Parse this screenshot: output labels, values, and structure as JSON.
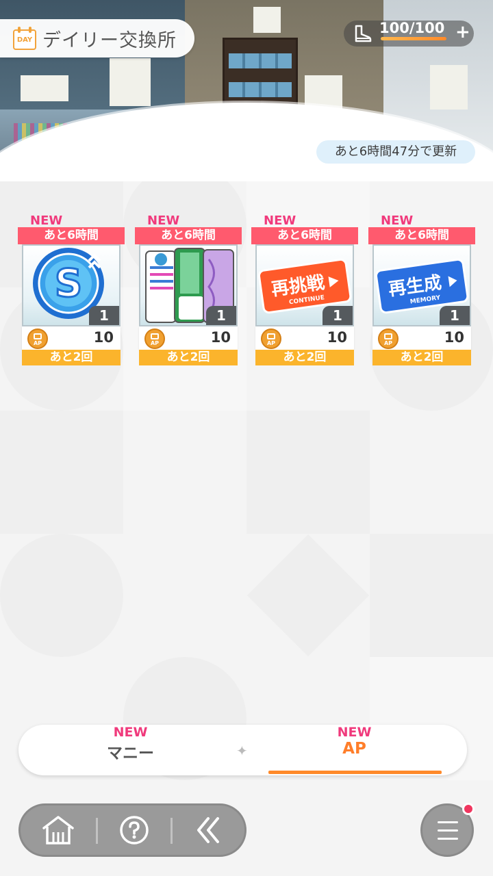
{
  "header": {
    "calendar_badge": "DAY",
    "title": "デイリー交換所",
    "stamina": "100/100",
    "stamina_fraction": 1.0,
    "stamina_plus": "+",
    "refresh_text": "あと6時間47分で更新"
  },
  "items": [
    {
      "new": "NEW",
      "timer": "あと6時間",
      "qty": "1",
      "cost_icon": "AP",
      "cost": "10",
      "remaining": "あと2回",
      "icon": "skill-up-coin-icon"
    },
    {
      "new": "NEW",
      "timer": "あと6時間",
      "qty": "1",
      "cost_icon": "AP",
      "cost": "10",
      "remaining": "あと2回",
      "icon": "books-icon"
    },
    {
      "new": "NEW",
      "timer": "あと6時間",
      "qty": "1",
      "cost_icon": "AP",
      "cost": "10",
      "remaining": "あと2回",
      "icon": "continue-ticket-icon",
      "ticket_main": "再挑戦",
      "ticket_sub": "CONTINUE"
    },
    {
      "new": "NEW",
      "timer": "あと6時間",
      "qty": "1",
      "cost_icon": "AP",
      "cost": "10",
      "remaining": "あと2回",
      "icon": "memory-ticket-icon",
      "ticket_main": "再生成",
      "ticket_sub": "MEMORY"
    }
  ],
  "tabs": [
    {
      "new": "NEW",
      "label": "マニー",
      "active": false
    },
    {
      "new": "NEW",
      "label": "AP",
      "active": true
    }
  ],
  "tab_separator": "✦",
  "nav": {
    "buttons": [
      "home-icon",
      "help-icon",
      "back-icon"
    ],
    "menu": "menu-icon",
    "notification": true
  },
  "colors": {
    "new": "#f03a7c",
    "timer": "#ff5a6e",
    "remaining": "#fbb42c",
    "accent": "#ff8a2a"
  }
}
